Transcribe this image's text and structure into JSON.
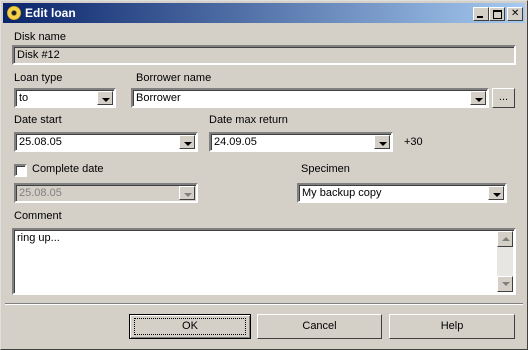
{
  "window": {
    "title": "Edit loan"
  },
  "disk_name": {
    "label": "Disk name",
    "value": "Disk #12"
  },
  "loan_type": {
    "label": "Loan type",
    "value": "to"
  },
  "borrower": {
    "label": "Borrower name",
    "value": "Borrower",
    "browse_label": "..."
  },
  "date_start": {
    "label": "Date start",
    "value": "25.08.05"
  },
  "date_max_return": {
    "label": "Date max return",
    "value": "24.09.05",
    "offset": "+30"
  },
  "complete_date": {
    "label": "Complete date",
    "checked": false,
    "value": "25.08.05"
  },
  "specimen": {
    "label": "Specimen",
    "value": "My backup copy"
  },
  "comment": {
    "label": "Comment",
    "value": "ring up..."
  },
  "buttons": {
    "ok": "OK",
    "cancel": "Cancel",
    "help": "Help"
  }
}
